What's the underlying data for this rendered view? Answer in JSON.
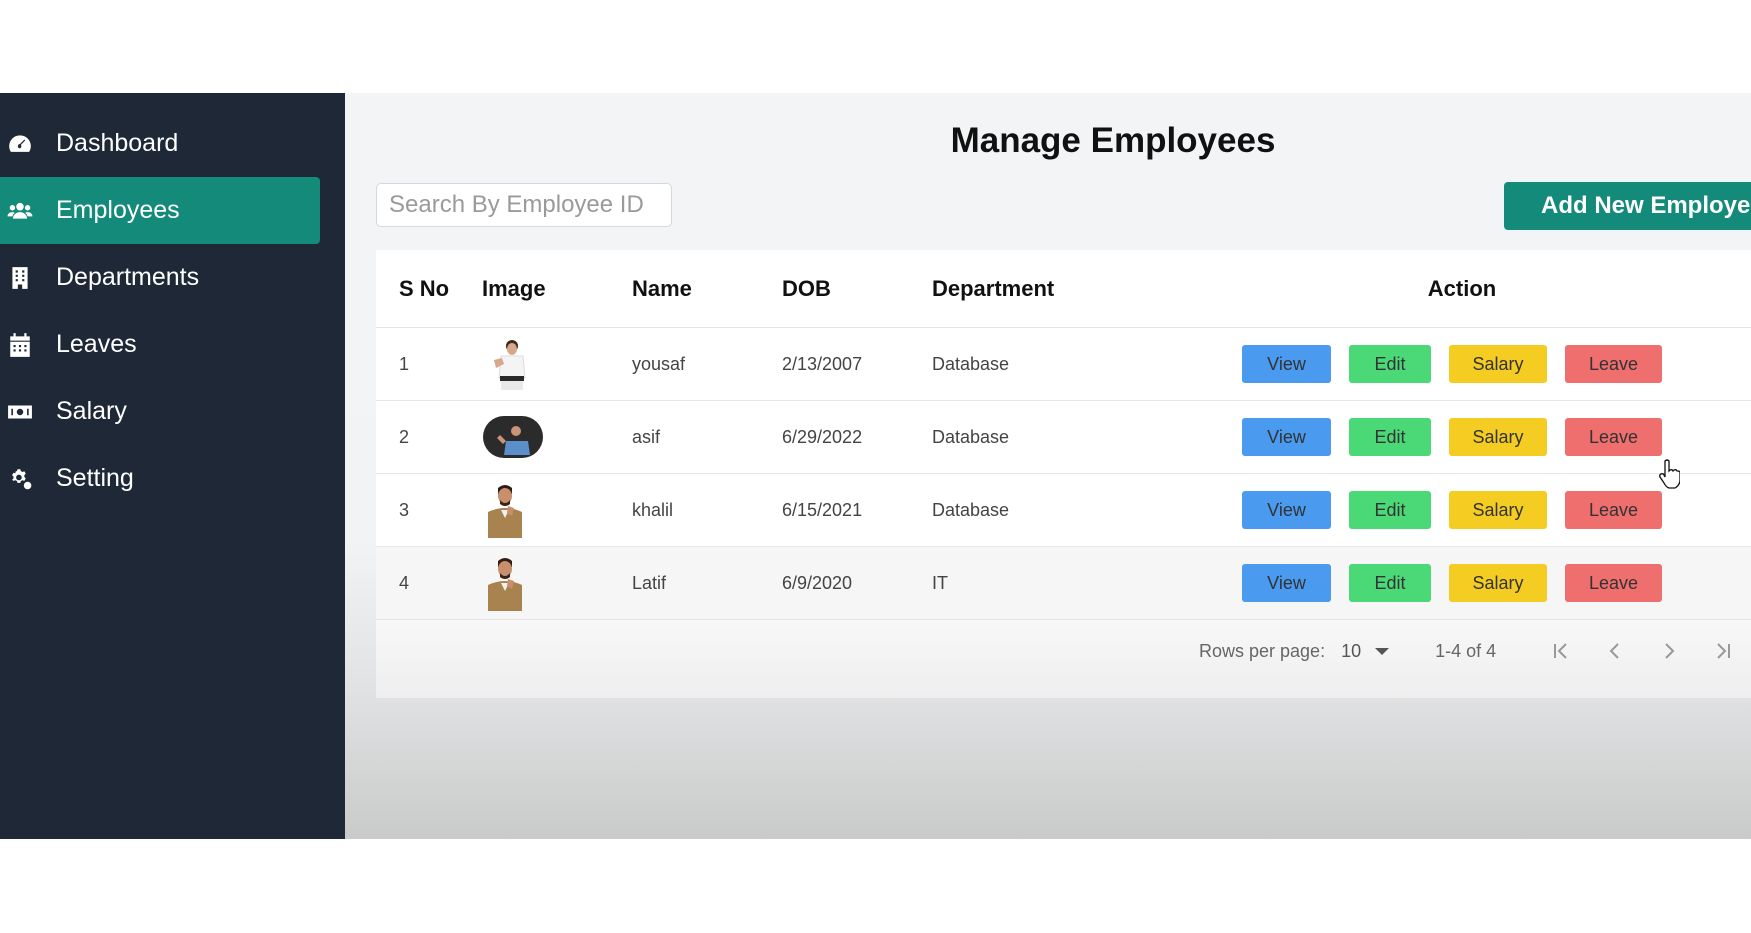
{
  "sidebar": {
    "items": [
      {
        "label": "Dashboard",
        "icon": "gauge-icon",
        "active": false
      },
      {
        "label": "Employees",
        "icon": "users-icon",
        "active": true
      },
      {
        "label": "Departments",
        "icon": "building-icon",
        "active": false
      },
      {
        "label": "Leaves",
        "icon": "calendar-icon",
        "active": false
      },
      {
        "label": "Salary",
        "icon": "money-icon",
        "active": false
      },
      {
        "label": "Setting",
        "icon": "gears-icon",
        "active": false
      }
    ]
  },
  "main": {
    "title": "Manage Employees",
    "search": {
      "placeholder": "Search By Employee ID",
      "value": ""
    },
    "add_button": "Add New Employee",
    "table": {
      "headers": {
        "sno": "S No",
        "image": "Image",
        "name": "Name",
        "dob": "DOB",
        "department": "Department",
        "action": "Action"
      },
      "rows": [
        {
          "sno": "1",
          "name": "yousaf",
          "dob": "2/13/2007",
          "department": "Database"
        },
        {
          "sno": "2",
          "name": "asif",
          "dob": "6/29/2022",
          "department": "Database"
        },
        {
          "sno": "3",
          "name": "khalil",
          "dob": "6/15/2021",
          "department": "Database"
        },
        {
          "sno": "4",
          "name": "Latif",
          "dob": "6/9/2020",
          "department": "IT"
        }
      ],
      "actions": {
        "view": "View",
        "edit": "Edit",
        "salary": "Salary",
        "leave": "Leave"
      }
    },
    "pagination": {
      "rows_per_page_label": "Rows per page:",
      "rows_per_page": "10",
      "range": "1-4 of 4"
    }
  },
  "colors": {
    "sidebar_bg": "#1e2836",
    "accent": "#148a7a",
    "view": "#4a9af0",
    "edit": "#4bd876",
    "salary": "#f4cc22",
    "leave": "#ef6e6e"
  }
}
